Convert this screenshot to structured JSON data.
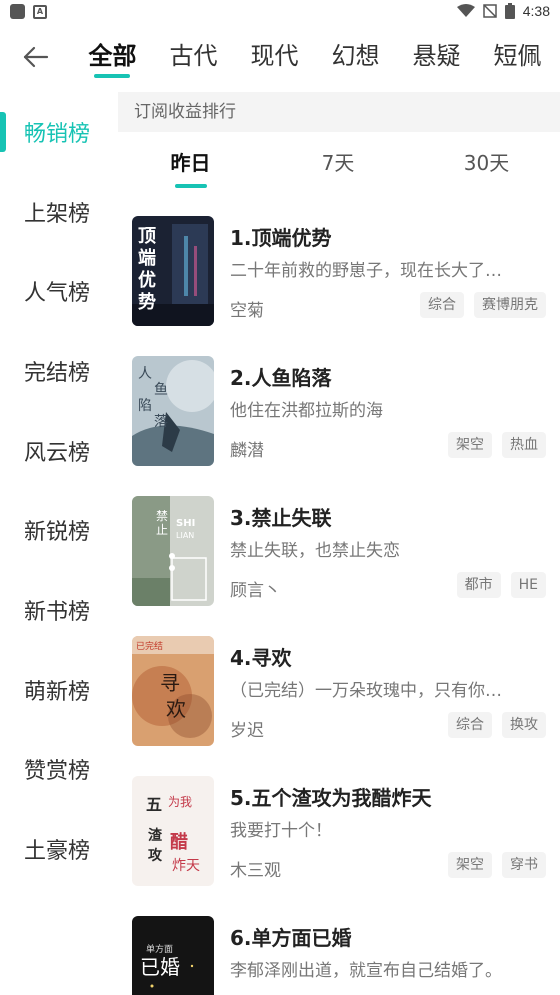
{
  "status_bar": {
    "time": "4:38"
  },
  "category_tabs": [
    {
      "label": "全部",
      "active": true
    },
    {
      "label": "古代",
      "active": false
    },
    {
      "label": "现代",
      "active": false
    },
    {
      "label": "幻想",
      "active": false
    },
    {
      "label": "悬疑",
      "active": false
    },
    {
      "label": "短佩",
      "active": false
    }
  ],
  "sidebar": {
    "items": [
      {
        "label": "畅销榜",
        "active": true
      },
      {
        "label": "上架榜"
      },
      {
        "label": "人气榜"
      },
      {
        "label": "完结榜"
      },
      {
        "label": "风云榜"
      },
      {
        "label": "新锐榜"
      },
      {
        "label": "新书榜"
      },
      {
        "label": "萌新榜"
      },
      {
        "label": "赞赏榜"
      },
      {
        "label": "土豪榜"
      }
    ]
  },
  "ranking": {
    "subtitle": "订阅收益排行",
    "periods": [
      {
        "label": "昨日",
        "active": true
      },
      {
        "label": "7天"
      },
      {
        "label": "30天"
      }
    ]
  },
  "books": [
    {
      "title": "1.顶端优势",
      "desc": "二十年前救的野崽子，现在长大了…",
      "author": "空菊",
      "tags": [
        "综合",
        "赛博朋克"
      ],
      "cover": {
        "text": "顶端优势",
        "bg": "#1b2233",
        "fg": "#ffffff"
      }
    },
    {
      "title": "2.人鱼陷落",
      "desc": "他住在洪都拉斯的海",
      "author": "麟潜",
      "tags": [
        "架空",
        "热血"
      ],
      "cover": {
        "text": "人鱼陷落",
        "bg": "#b9c7cf",
        "fg": "#3a4a58"
      }
    },
    {
      "title": "3.禁止失联",
      "desc": "禁止失联，也禁止失恋",
      "author": "顾言丶",
      "tags": [
        "都市",
        "HE"
      ],
      "cover": {
        "text": "禁止失联",
        "bg": "#8a9a86",
        "fg": "#ffffff"
      }
    },
    {
      "title": "4.寻欢",
      "desc": "（已完结）一万朵玫瑰中，只有你…",
      "author": "岁迟",
      "tags": [
        "综合",
        "换攻"
      ],
      "cover": {
        "text": "寻欢",
        "bg": "#c98a5a",
        "fg": "#2a1a12"
      }
    },
    {
      "title": "5.五个渣攻为我醋炸天",
      "desc": "我要打十个！",
      "author": "木三观",
      "tags": [
        "架空",
        "穿书"
      ],
      "cover": {
        "text": "五个渣攻",
        "bg": "#f6f1ee",
        "fg": "#c43a4a"
      }
    },
    {
      "title": "6.单方面已婚",
      "desc": "李郁泽刚出道，就宣布自己结婚了。",
      "author": "",
      "tags": [],
      "cover": {
        "text": "已婚",
        "bg": "#141414",
        "fg": "#ffffff"
      }
    }
  ],
  "colors": {
    "accent": "#17c3b4"
  }
}
